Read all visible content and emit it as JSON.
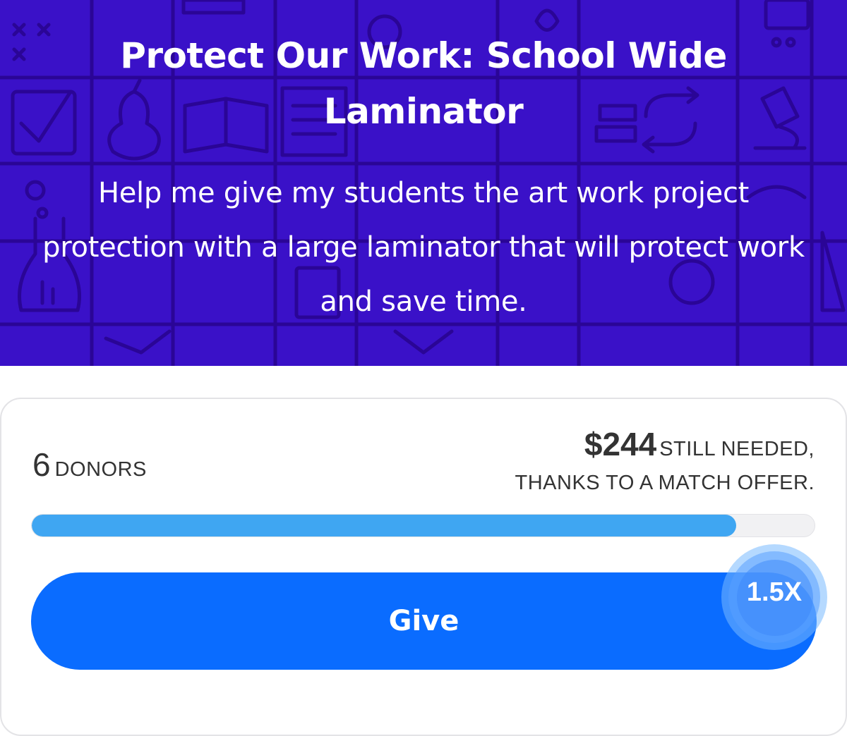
{
  "hero": {
    "title": "Protect Our Work: School Wide Laminator",
    "subtitle": "Help me give my students the art work project protection with a large laminator that will protect work and save time.",
    "background_color": "#3a11c8"
  },
  "funding": {
    "donor_count": "6",
    "donor_label": "DONORS",
    "amount_needed": "$244",
    "needed_label": "STILL NEEDED,",
    "match_note": "THANKS TO A MATCH OFFER.",
    "progress_percent": 90,
    "progress_color": "#3fa6f2"
  },
  "give_button": {
    "label": "Give",
    "color": "#0a6cff"
  },
  "match_badge": {
    "label": "1.5X"
  }
}
